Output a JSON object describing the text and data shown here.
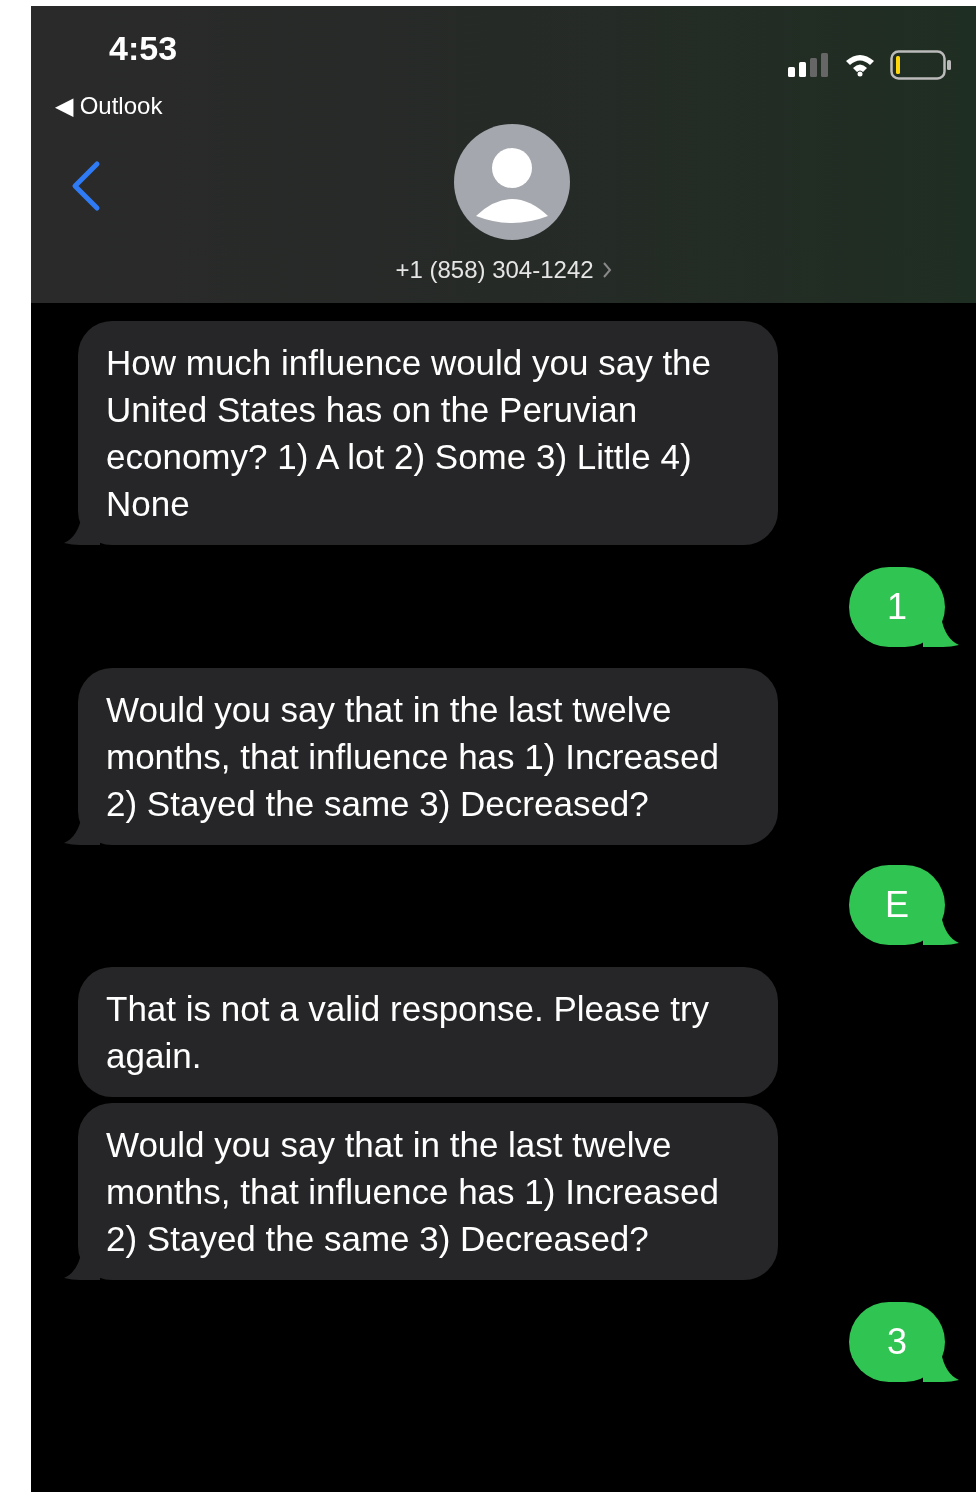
{
  "status_bar": {
    "time": "4:53",
    "back_app": "◀ Outlook"
  },
  "contact": {
    "phone": "+1 (858) 304-1242"
  },
  "messages": [
    {
      "kind": "incoming",
      "text": "How much influence would you say the United States has on the Peruvian economy? 1) A lot 2) Some 3) Little 4) None",
      "tail": true
    },
    {
      "kind": "outgoing",
      "text": "1",
      "tail": true
    },
    {
      "kind": "incoming",
      "text": "Would you say that in the last twelve months, that influence has 1) Increased 2) Stayed the same 3) Decreased?",
      "tail": true
    },
    {
      "kind": "outgoing",
      "text": "E",
      "tail": true
    },
    {
      "kind": "incoming",
      "text": "That is not a valid response. Please try again.",
      "tail": false
    },
    {
      "kind": "incoming",
      "text": "Would you say that in the last twelve months, that influence has 1) Increased 2) Stayed the same 3) Decreased?",
      "tail": true
    },
    {
      "kind": "outgoing",
      "text": "3",
      "tail": true
    }
  ]
}
